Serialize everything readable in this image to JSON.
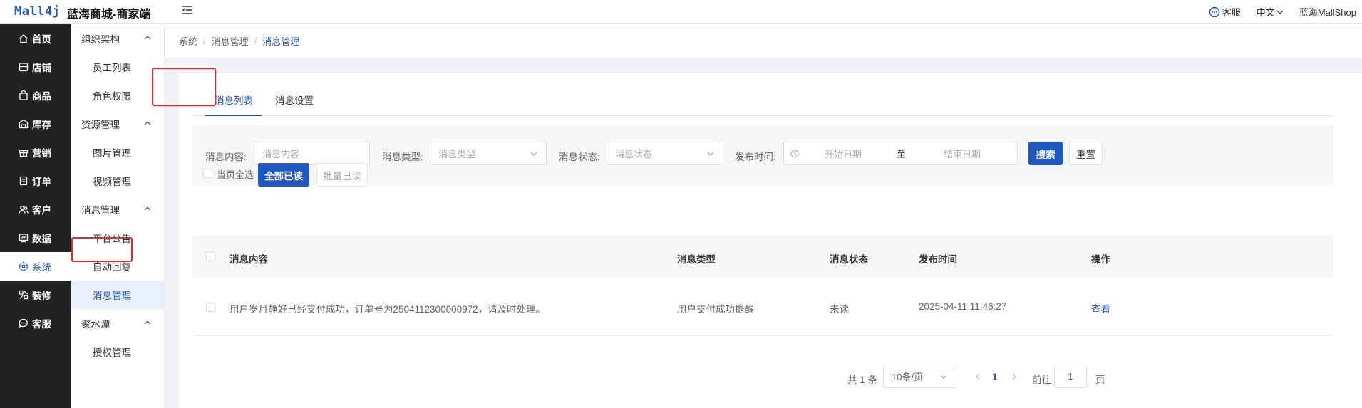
{
  "header": {
    "logo": "Mall4j",
    "app_name": "蓝海商城-商家端",
    "service": "客服",
    "language": "中文",
    "shop_name": "蓝海MallShop"
  },
  "primary_nav": [
    {
      "label": "首页",
      "icon": "home-icon"
    },
    {
      "label": "店铺",
      "icon": "store-icon"
    },
    {
      "label": "商品",
      "icon": "bag-icon"
    },
    {
      "label": "库存",
      "icon": "stock-icon"
    },
    {
      "label": "营销",
      "icon": "gift-icon"
    },
    {
      "label": "订单",
      "icon": "order-icon"
    },
    {
      "label": "客户",
      "icon": "customer-icon"
    },
    {
      "label": "数据",
      "icon": "chart-icon"
    },
    {
      "label": "系统",
      "icon": "gear-icon",
      "active": true
    },
    {
      "label": "装修",
      "icon": "decorate-icon"
    },
    {
      "label": "客服",
      "icon": "chat-icon"
    }
  ],
  "secondary_nav": {
    "group_org": "组织架构",
    "employee_list": "员工列表",
    "role_permission": "角色权限",
    "group_resource": "资源管理",
    "image_manage": "图片管理",
    "video_manage": "视频管理",
    "group_message": "消息管理",
    "platform_notice": "平台公告",
    "auto_reply": "自动回复",
    "message_manage": "消息管理",
    "group_jushuitan": "聚水潭",
    "auth_manage": "授权管理"
  },
  "breadcrumb": {
    "level1": "系统",
    "level2": "消息管理",
    "current": "消息管理",
    "separator": "/"
  },
  "tabs": {
    "list": "消息列表",
    "settings": "消息设置"
  },
  "filter": {
    "content_label": "消息内容:",
    "content_placeholder": "消息内容",
    "type_label": "消息类型:",
    "type_placeholder": "消息类型",
    "status_label": "消息状态:",
    "status_placeholder": "消息状态",
    "time_label": "发布时间:",
    "start_placeholder": "开始日期",
    "range_sep": "至",
    "end_placeholder": "结束日期",
    "search_btn": "搜索",
    "reset_btn": "重置"
  },
  "actions": {
    "select_page": "当页全选",
    "mark_all_read": "全部已读",
    "batch_read": "批量已读"
  },
  "table": {
    "columns": {
      "content": "消息内容",
      "type": "消息类型",
      "status": "消息状态",
      "time": "发布时间",
      "op": "操作"
    },
    "rows": [
      {
        "content": "用户岁月静好已经支付成功，订单号为2504112300000972，请及时处理。",
        "type": "用户支付成功提醒",
        "status": "未读",
        "time": "2025-04-11 11:46:27",
        "op": "查看"
      }
    ]
  },
  "pagination": {
    "total": "共 1 条",
    "page_size": "10条/页",
    "current_page": "1",
    "goto_label": "前往",
    "goto_value": "1",
    "page_suffix": "页"
  },
  "colors": {
    "accent": "#1f57c3",
    "sidebar_bg": "#222222",
    "highlight_box": "#e8262d"
  }
}
